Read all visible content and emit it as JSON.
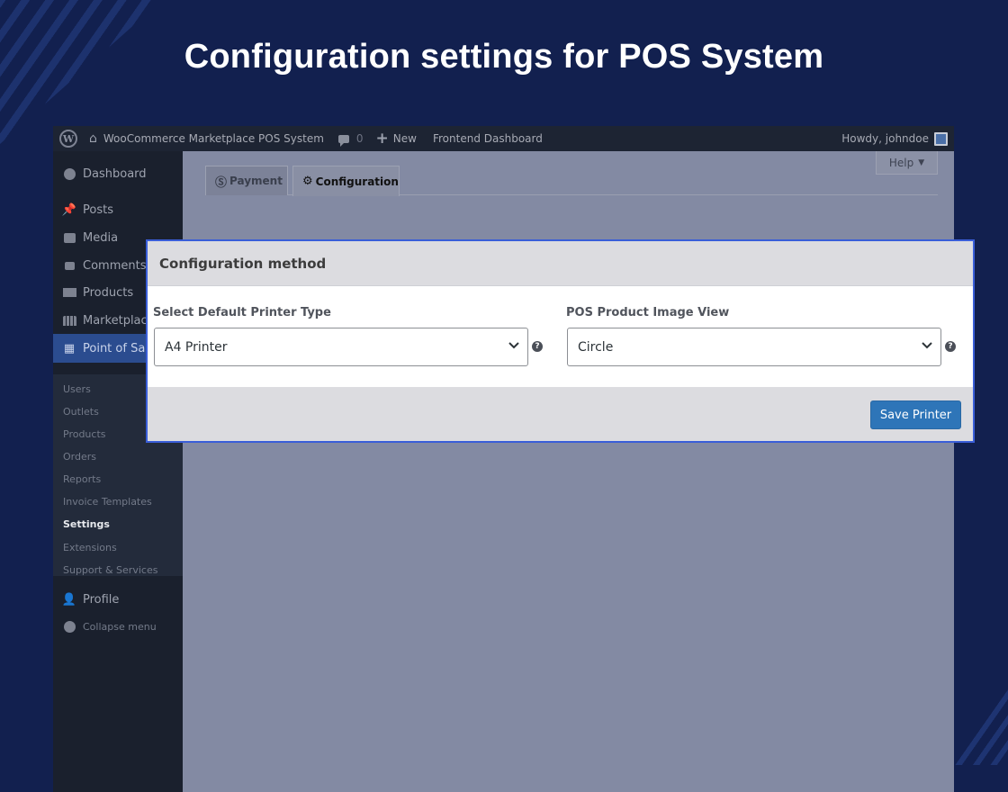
{
  "headline": "Configuration settings for POS System",
  "adminbar": {
    "site_name": "WooCommerce Marketplace POS System",
    "comments_count": "0",
    "new_label": "New",
    "frontend_label": "Frontend Dashboard",
    "howdy": "Howdy, johndoe"
  },
  "sidebar": {
    "items": [
      {
        "label": "Dashboard",
        "icon": "dashboard-icon"
      },
      {
        "label": "Posts",
        "icon": "pin-icon"
      },
      {
        "label": "Media",
        "icon": "media-icon"
      },
      {
        "label": "Comments",
        "icon": "comment-icon"
      },
      {
        "label": "Products",
        "icon": "archive-icon"
      },
      {
        "label": "Marketplace",
        "icon": "store-icon"
      },
      {
        "label": "Point of Sale",
        "icon": "calculator-icon"
      }
    ],
    "submenu": [
      "Users",
      "Outlets",
      "Products",
      "Orders",
      "Reports",
      "Invoice Templates",
      "Settings",
      "Extensions",
      "Support & Services"
    ],
    "current_submenu": "Settings",
    "profile_label": "Profile",
    "collapse_label": "Collapse menu"
  },
  "tabs": {
    "payment": "Payment",
    "configuration": "Configuration",
    "active": "Configuration"
  },
  "help_label": "Help",
  "panel": {
    "title": "Configuration method",
    "printer_label": "Select Default Printer Type",
    "printer_value": "A4 Printer",
    "image_view_label": "POS Product Image View",
    "image_view_value": "Circle",
    "save_label": "Save Printer"
  },
  "colors": {
    "background": "#12204f",
    "accent_border": "#3a5ed8",
    "save_button": "#2e75b8",
    "active_menu": "#2b4c8f"
  }
}
